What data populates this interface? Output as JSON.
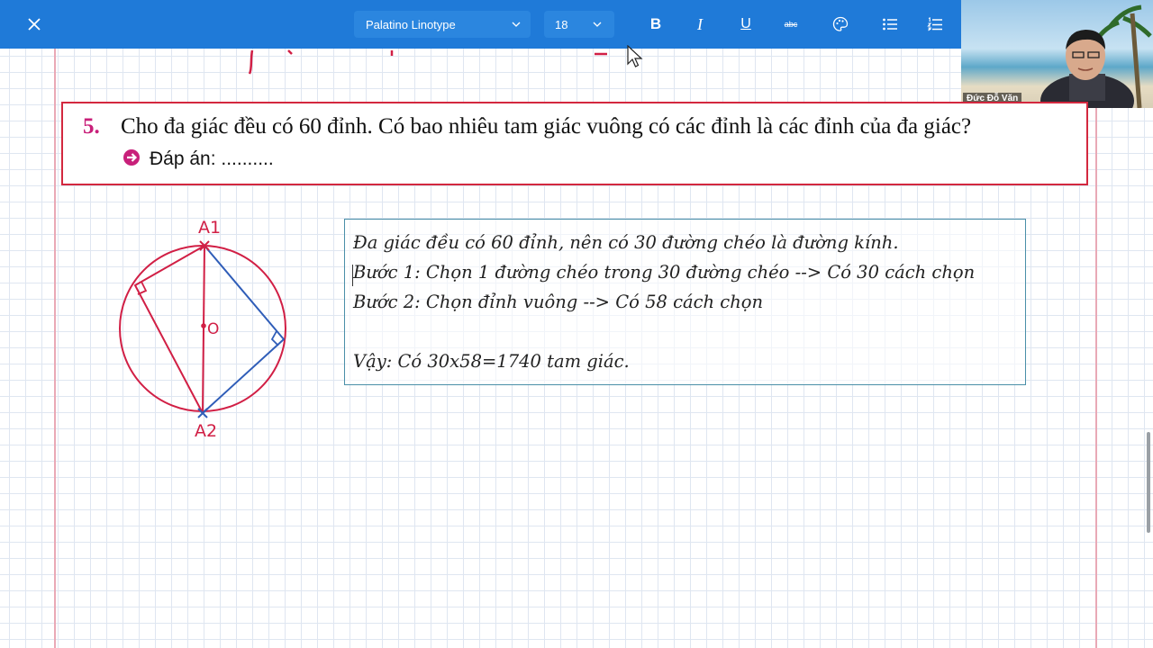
{
  "toolbar": {
    "font_family": "Palatino Linotype",
    "font_size": "18",
    "buttons": [
      "bold",
      "italic",
      "underline",
      "strikethrough",
      "text-color",
      "bulleted-list",
      "numbered-list"
    ],
    "accent_color": "#1f7ad8"
  },
  "webcam": {
    "name": "Đức Đỗ Văn"
  },
  "question": {
    "number": "5.",
    "text": "Cho đa giác đều có 60 đỉnh. Có bao nhiêu tam giác vuông có các đỉnh là các đỉnh của đa giác?",
    "answer_label": "Đáp án: ..........",
    "border_color": "#d3283f"
  },
  "solution": {
    "line1": "Đa giác đều có 60 đỉnh, nên có 30 đường chéo là đường kính.",
    "line2": "Bước 1: Chọn 1 đường chéo trong 30 đường chéo --> Có 30 cách chọn",
    "line3": "Bước 2: Chọn đỉnh vuông --> Có 58 cách chọn",
    "line4": "Vậy: Có 30x58=1740 tam giác."
  },
  "diagram": {
    "label_top": "A1",
    "label_bottom": "A2",
    "label_center": "O",
    "circle_color": "#d11f45",
    "triangle_color": "#2f5db8"
  }
}
